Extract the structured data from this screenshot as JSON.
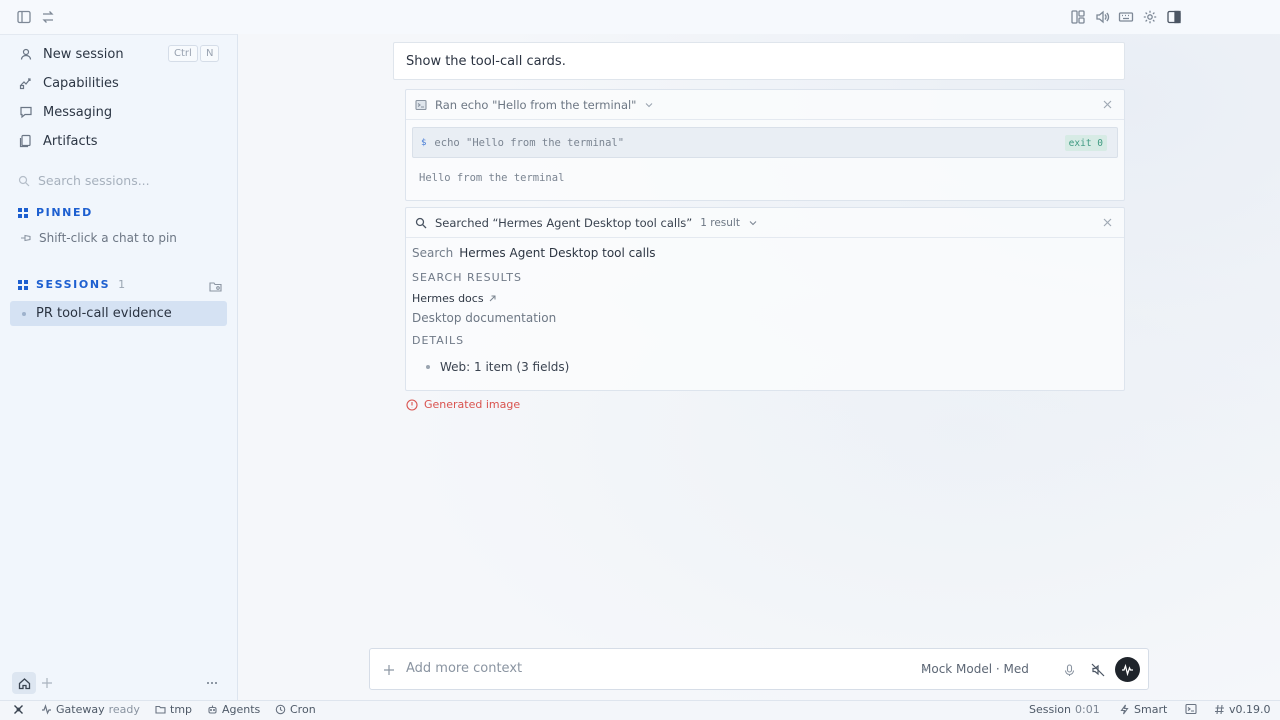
{
  "sidebar": {
    "nav": [
      {
        "label": "New session",
        "icon": "new-session-icon",
        "shortcut": [
          "Ctrl",
          "N"
        ]
      },
      {
        "label": "Capabilities",
        "icon": "capabilities-icon"
      },
      {
        "label": "Messaging",
        "icon": "message-icon"
      },
      {
        "label": "Artifacts",
        "icon": "artifacts-icon"
      }
    ],
    "search_placeholder": "Search sessions...",
    "pinned": {
      "title": "PINNED",
      "hint": "Shift-click a chat to pin"
    },
    "sessions": {
      "title": "SESSIONS",
      "count": "1",
      "items": [
        "PR tool-call evidence"
      ]
    }
  },
  "conversation": {
    "user_message": "Show the tool-call cards.",
    "terminal_card": {
      "title": "Ran echo \"Hello from the terminal\"",
      "command_prompt": "$",
      "command": "echo \"Hello from the terminal\"",
      "exit_badge": "exit 0",
      "output": "Hello from the terminal"
    },
    "search_card": {
      "title": "Searched “Hermes Agent Desktop tool calls”",
      "result_count": "1 result",
      "search_label": "Search",
      "query": "Hermes Agent Desktop tool calls",
      "results_heading": "SEARCH RESULTS",
      "result_title": "Hermes docs",
      "result_subtitle": "Desktop documentation",
      "details_heading": "DETAILS",
      "details_item": "Web: 1 item (3 fields)"
    },
    "generated_image_label": "Generated image"
  },
  "composer": {
    "placeholder": "Add more context",
    "model": "Mock Model · Med"
  },
  "statusbar": {
    "gateway": "Gateway",
    "gateway_status": "ready",
    "folder": "tmp",
    "agents": "Agents",
    "cron": "Cron",
    "session_label": "Session",
    "session_time": "0:01",
    "mode": "Smart",
    "version": "v0.19.0"
  },
  "colors": {
    "accent": "#1d5fd0",
    "error": "#d9534f",
    "exit_ok": "#3f9a82",
    "selected_row": "#d5e2f3"
  }
}
